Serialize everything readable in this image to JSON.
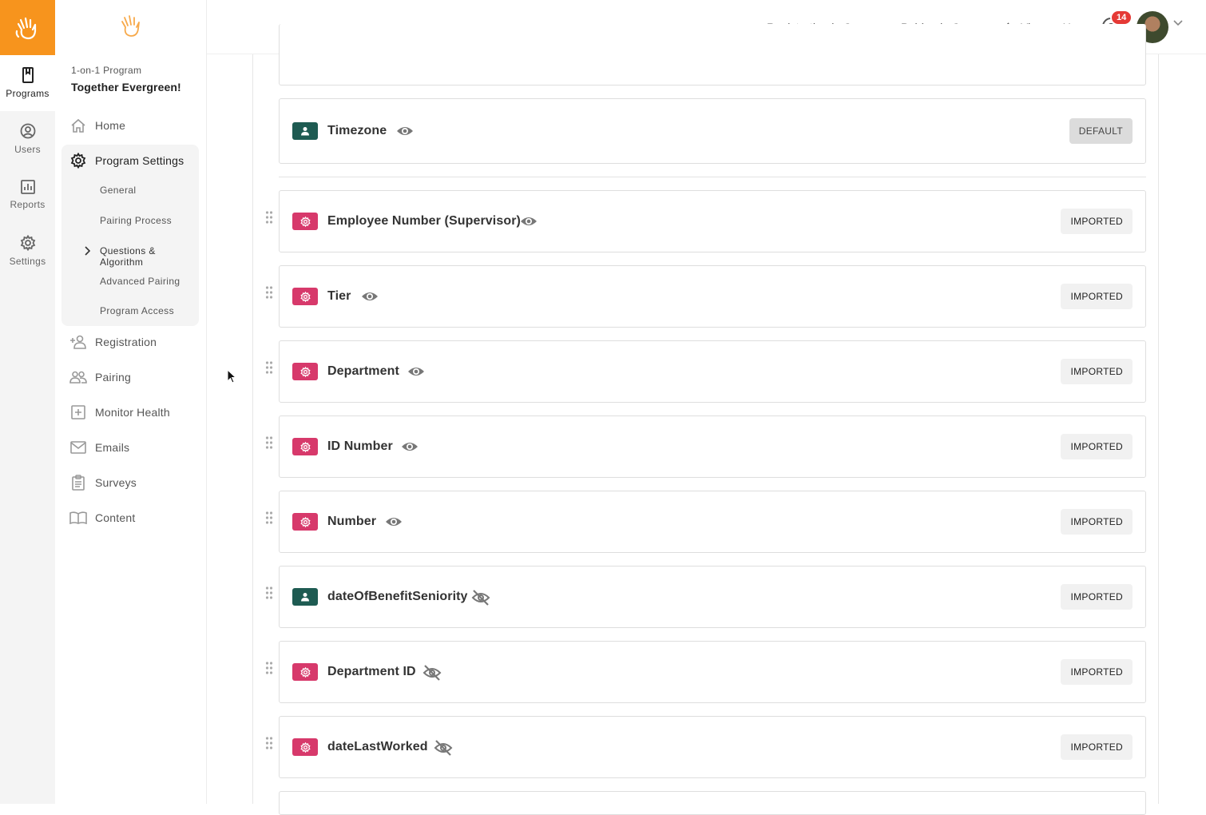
{
  "rail": {
    "items": [
      {
        "label": "Programs",
        "icon": "programs-icon",
        "active": true
      },
      {
        "label": "Users",
        "icon": "users-icon"
      },
      {
        "label": "Reports",
        "icon": "reports-icon"
      },
      {
        "label": "Settings",
        "icon": "settings-icon"
      }
    ]
  },
  "sidebar": {
    "program_kind": "1-on-1 Program",
    "program_name": "Together Evergreen!",
    "nav": {
      "home": "Home",
      "program_settings": "Program Settings",
      "registration": "Registration",
      "pairing": "Pairing",
      "monitor_health": "Monitor Health",
      "emails": "Emails",
      "surveys": "Surveys",
      "content": "Content"
    },
    "settings_sub": {
      "general": "General",
      "pairing_process": "Pairing Process",
      "questions": "Questions & Algorithm",
      "advanced_pairing": "Advanced Pairing",
      "program_access": "Program Access"
    }
  },
  "topbar": {
    "registration_status": "Registration is Open",
    "pairing_status": "Pairing is Open",
    "view_as_user": "View as User",
    "notification_count": "14",
    "status_color": "#43a047"
  },
  "fields": [
    {
      "label": "Timezone",
      "type": "user",
      "visible": true,
      "tag": "DEFAULT"
    },
    {
      "label": "Employee Number (Supervisor)",
      "type": "imported",
      "visible": true,
      "tag": "IMPORTED"
    },
    {
      "label": "Tier",
      "type": "imported",
      "visible": true,
      "tag": "IMPORTED"
    },
    {
      "label": "Department",
      "type": "imported",
      "visible": true,
      "tag": "IMPORTED"
    },
    {
      "label": "ID Number",
      "type": "imported",
      "visible": true,
      "tag": "IMPORTED"
    },
    {
      "label": "Number",
      "type": "imported",
      "visible": true,
      "tag": "IMPORTED"
    },
    {
      "label": "dateOfBenefitSeniority",
      "type": "user",
      "visible": false,
      "tag": "IMPORTED"
    },
    {
      "label": "Department ID",
      "type": "imported",
      "visible": false,
      "tag": "IMPORTED"
    },
    {
      "label": "dateLastWorked",
      "type": "imported",
      "visible": false,
      "tag": "IMPORTED"
    }
  ],
  "colors": {
    "brand": "#f7941d",
    "user_field": "#1e5b52",
    "imported_field": "#d7396b"
  }
}
